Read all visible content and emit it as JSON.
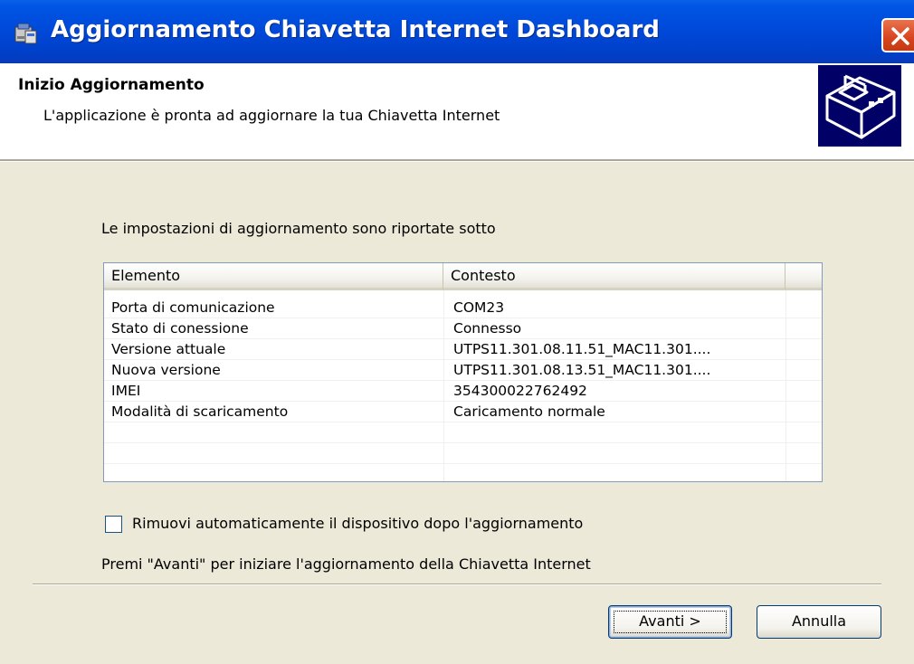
{
  "window": {
    "title": "Aggiornamento Chiavetta Internet Dashboard"
  },
  "header": {
    "title": "Inizio Aggiornamento",
    "subtitle": "L'applicazione è pronta ad aggiornare la tua Chiavetta Internet"
  },
  "body": {
    "intro": "Le impostazioni di aggiornamento sono riportate sotto",
    "table": {
      "columns": [
        "Elemento",
        "Contesto",
        ""
      ],
      "rows": [
        {
          "element": "Porta di comunicazione",
          "context": "COM23"
        },
        {
          "element": "Stato di conessione",
          "context": "Connesso"
        },
        {
          "element": "Versione attuale",
          "context": "UTPS11.301.08.11.51_MAC11.301...."
        },
        {
          "element": "Nuova versione",
          "context": "UTPS11.301.08.13.51_MAC11.301...."
        },
        {
          "element": "IMEI",
          "context": "354300022762492"
        },
        {
          "element": "Modalità di scaricamento",
          "context": "Caricamento normale"
        },
        {
          "element": "",
          "context": ""
        },
        {
          "element": "",
          "context": ""
        }
      ]
    },
    "checkbox": {
      "label": "Rimuovi automaticamente il dispositivo dopo l'aggiornamento",
      "checked": false
    },
    "instruction": "Premi \"Avanti\" per iniziare l'aggiornamento della Chiavetta Internet"
  },
  "buttons": {
    "next": "Avanti >",
    "cancel": "Annulla"
  },
  "colors": {
    "titlebar": "#0055E5",
    "dialog_bg": "#ECE9D8",
    "close_button": "#D8431E"
  },
  "icons": {
    "title_icon": "installer-icon",
    "header_image": "device-box-icon",
    "close": "close-icon"
  }
}
